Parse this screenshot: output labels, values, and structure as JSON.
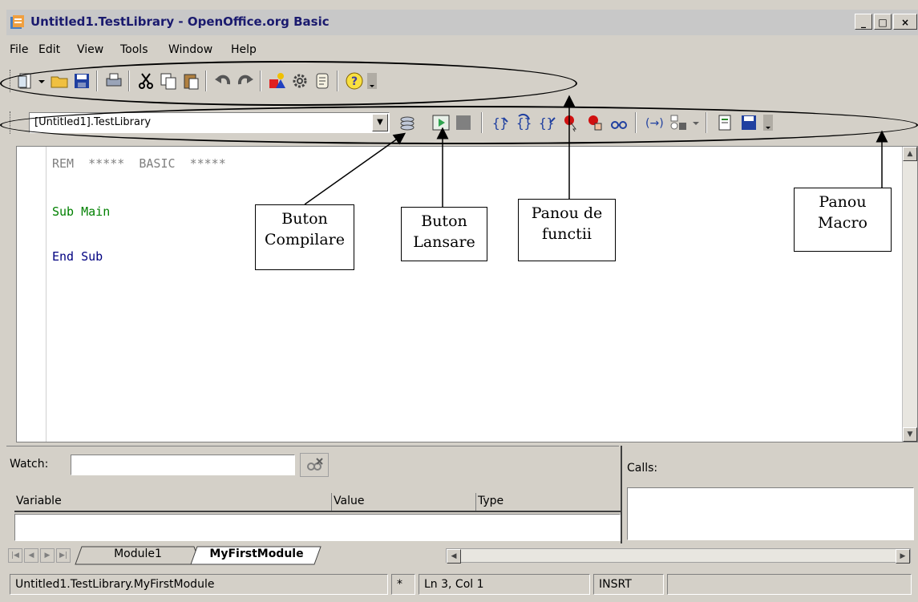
{
  "window": {
    "title": "Untitled1.TestLibrary - OpenOffice.org Basic",
    "minimize": "_",
    "maximize": "□",
    "close": "×"
  },
  "menu": [
    "File",
    "Edit",
    "View",
    "Tools",
    "Window",
    "Help"
  ],
  "macro_toolbar": {
    "library_value": "[Untitled1].TestLibrary"
  },
  "editor": {
    "lines": [
      {
        "text": "REM  *****  BASIC  *****",
        "color": "#808080"
      },
      {
        "text": "Sub Main",
        "color": "#008000"
      },
      {
        "text": "End Sub",
        "color": "#000080"
      }
    ]
  },
  "callouts": {
    "compile": "Buton\nCompilare",
    "run": "Buton\nLansare",
    "functions": "Panou de\nfunctii",
    "macro": "Panou\nMacro"
  },
  "watch": {
    "label": "Watch:",
    "input_value": "",
    "columns": [
      "Variable",
      "Value",
      "Type"
    ]
  },
  "calls": {
    "label": "Calls:"
  },
  "tabs": [
    {
      "label": "Module1",
      "active": false
    },
    {
      "label": "MyFirstModule",
      "active": true
    }
  ],
  "status": {
    "path": "Untitled1.TestLibrary.MyFirstModule",
    "modified": "*",
    "position": "Ln 3, Col 1",
    "mode": "INSRT"
  },
  "colors": {
    "title_text": "#1a1a6e",
    "chrome": "#d4d0c8",
    "run_green": "#2ea44f"
  }
}
